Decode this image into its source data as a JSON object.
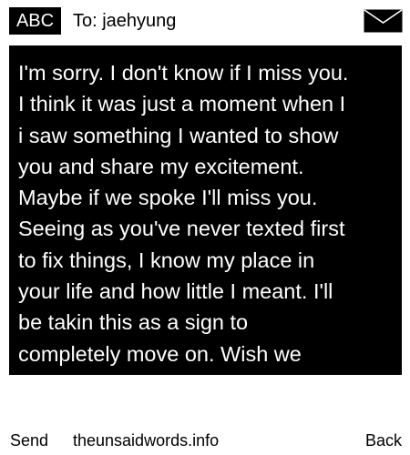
{
  "header": {
    "mode_badge": "ABC",
    "recipient": "To: jaehyung",
    "envelope_icon": "envelope-icon"
  },
  "message": {
    "body": "I'm sorry. I don't know if I miss you.\nI think it was just a moment when I\ni saw something I wanted to show\nyou and share my excitement.\nMaybe if we spoke I'll miss you.\nSeeing as you've never texted first\nto fix things, I know my place in\nyour life and how little I meant. I'll\nbe takin this as a sign to\ncompletely move on. Wish we"
  },
  "footer": {
    "left_softkey": "Send",
    "site": "theunsaidwords.info",
    "right_softkey": "Back"
  },
  "colors": {
    "background": "#ffffff",
    "foreground": "#000000",
    "message_background": "#000000",
    "message_text": "#ffffff"
  }
}
